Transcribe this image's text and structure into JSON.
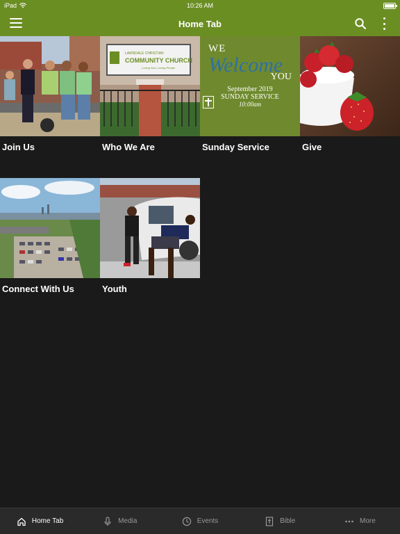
{
  "status": {
    "device": "iPad",
    "time": "10:26 AM"
  },
  "header": {
    "title": "Home Tab"
  },
  "tiles": [
    {
      "label": "Join Us"
    },
    {
      "label": "Who We Are",
      "sign_line1": "LAWNDALE CHRISTIAN",
      "sign_line2": "COMMUNITY CHURCH",
      "sign_line3": "Loving God, Loving People"
    },
    {
      "label": "Sunday Service",
      "we": "WE",
      "welcome": "Welcome",
      "you": "YOU",
      "date": "September 2019",
      "service": "SUNDAY SERVICE",
      "hour": "10:00am"
    },
    {
      "label": "Give"
    },
    {
      "label": "Connect With Us"
    },
    {
      "label": "Youth"
    }
  ],
  "nav": [
    {
      "label": "Home Tab",
      "icon": "home-icon"
    },
    {
      "label": "Media",
      "icon": "microphone-icon"
    },
    {
      "label": "Events",
      "icon": "clock-icon"
    },
    {
      "label": "Bible",
      "icon": "bible-icon"
    },
    {
      "label": "More",
      "icon": "more-icon"
    }
  ],
  "colors": {
    "brand": "#6b8e23",
    "background": "#1a1a1a",
    "nav": "#2a2a2a"
  }
}
